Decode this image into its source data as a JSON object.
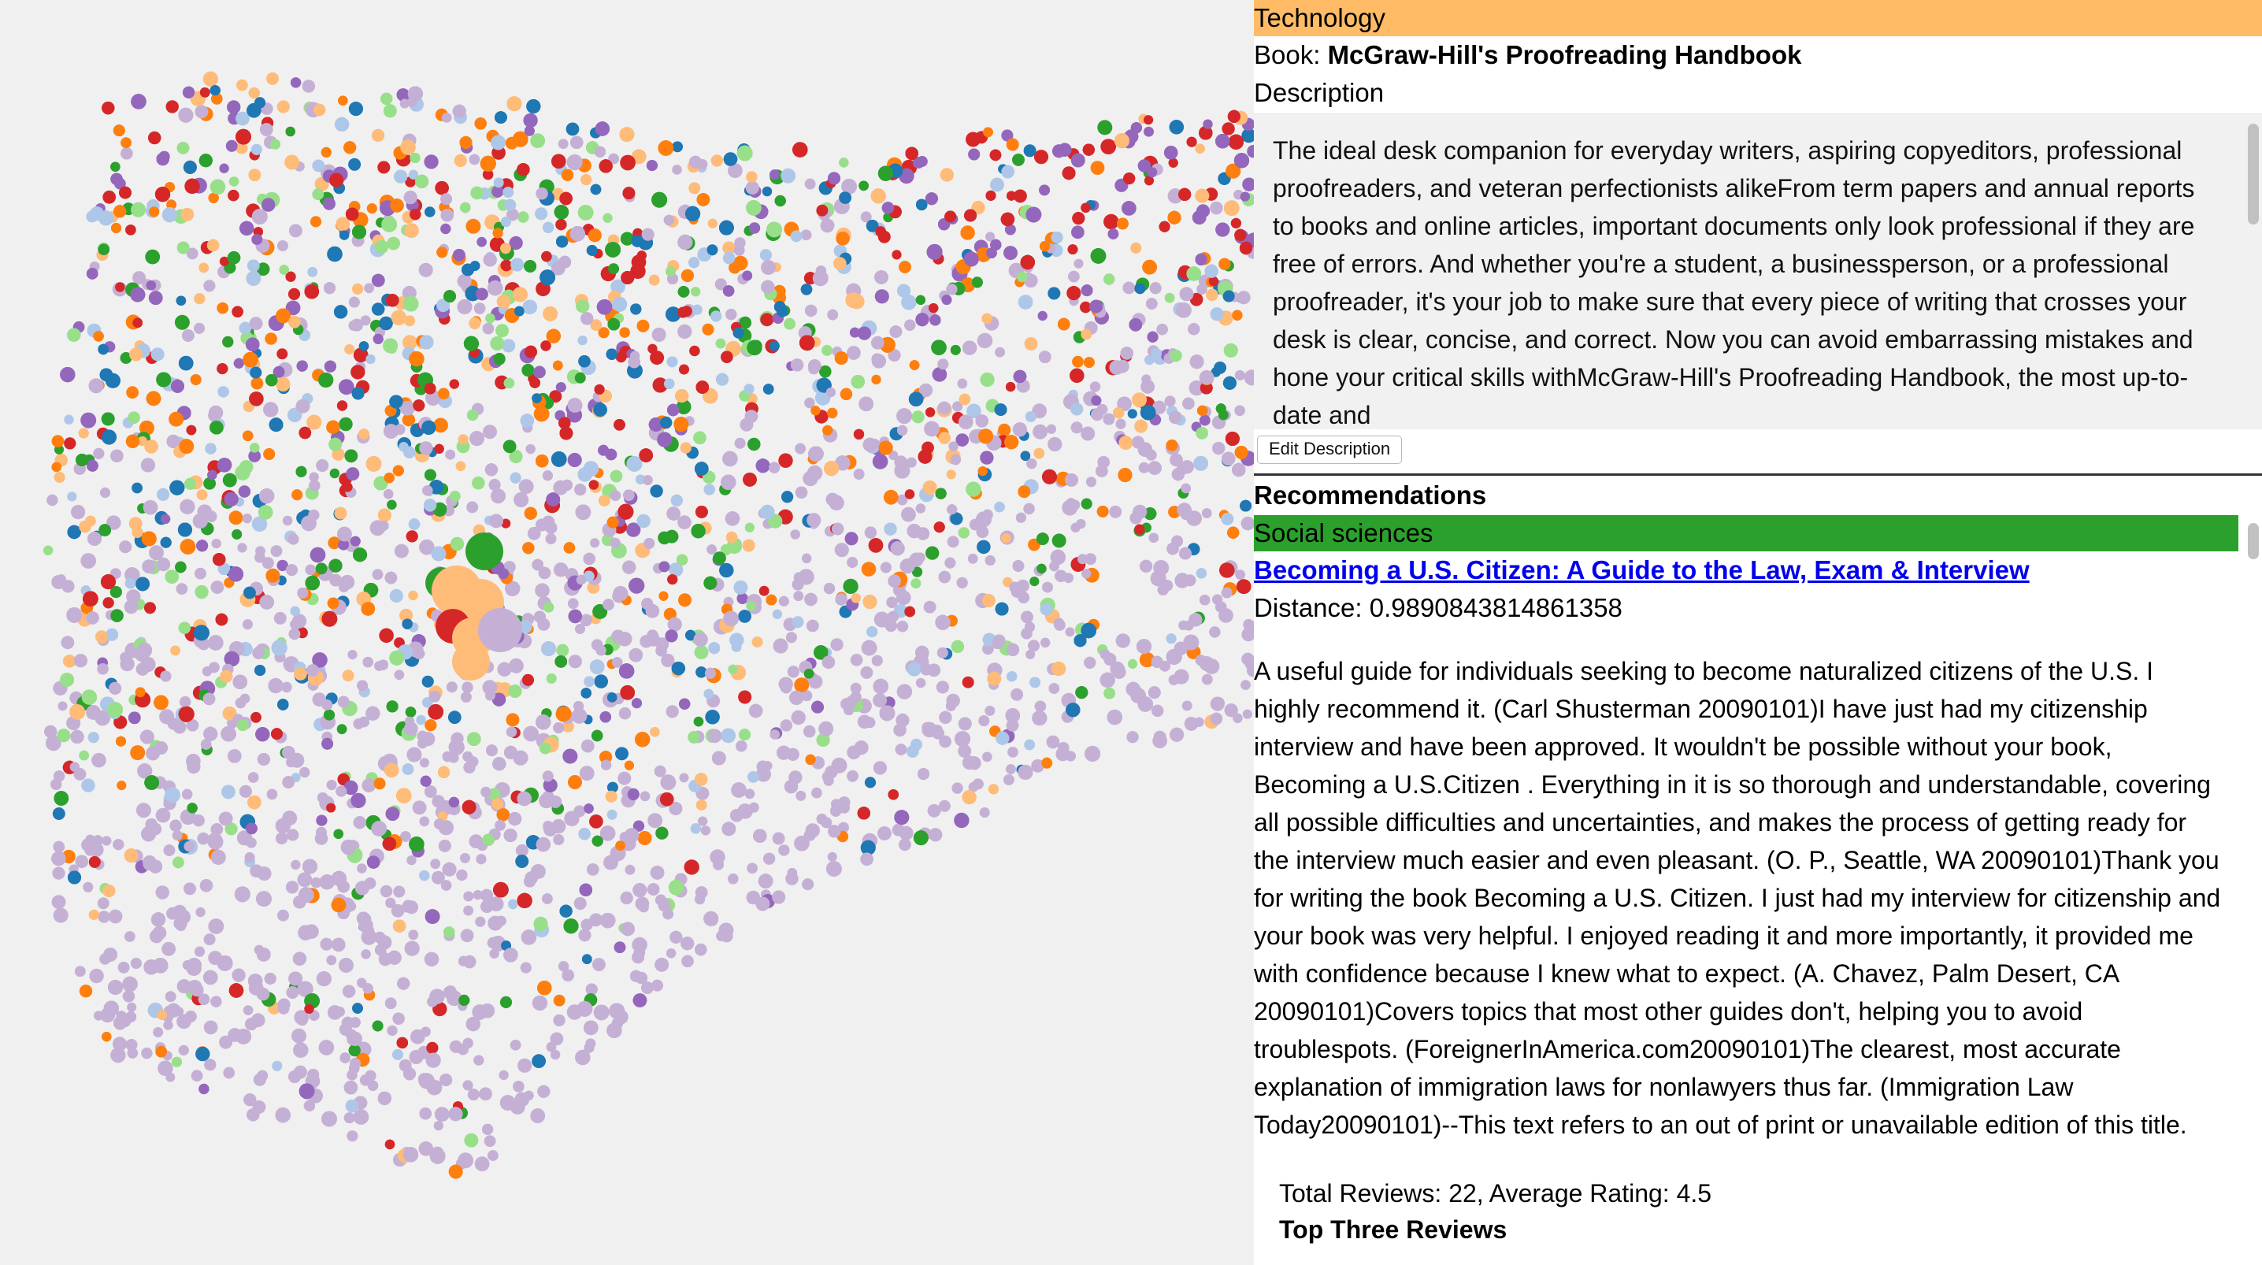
{
  "panel": {
    "current_category": "Technology",
    "book_label": "Book:",
    "book_title": "McGraw-Hill's Proofreading Handbook",
    "description_label": "Description",
    "description_text": "The ideal desk companion for everyday writers, aspiring copyeditors, professional proofreaders, and veteran perfectionists alikeFrom term papers and annual reports to books and online articles, important documents only look professional if they are free of errors. And whether you're a student, a businessperson, or a professional proofreader, it's your job to make sure that every piece of writing that crosses your desk is clear, concise, and correct. Now you can avoid embarrassing mistakes and hone your critical skills withMcGraw-Hill's Proofreading Handbook, the most up-to-date and",
    "edit_description_label": "Edit Description",
    "recommendations_label": "Recommendations",
    "recommendation": {
      "category": "Social sciences",
      "title": "Becoming a U.S. Citizen: A Guide to the Law, Exam & Interview",
      "distance": "Distance: 0.9890843814861358",
      "description": "A useful guide for individuals seeking to become naturalized citizens of the U.S. I highly recommend it. (Carl Shusterman 20090101)I have just had my citizenship interview and have been approved. It wouldn't be possible without your book, Becoming a U.S.Citizen . Everything in it is so thorough and understandable, covering all possible difficulties and uncertainties, and makes the process of getting ready for the interview much easier and even pleasant. (O. P., Seattle, WA 20090101)Thank you for writing the book Becoming a U.S. Citizen. I just had my interview for citizenship and your book was very helpful. I enjoyed reading it and more importantly, it provided me with confidence because I knew what to expect. (A. Chavez, Palm Desert, CA 20090101)Covers topics that most other guides don't, helping you to avoid troublespots. (ForeignerInAmerica.com20090101)The clearest, most accurate explanation of immigration laws for nonlawyers thus far. (Immigration Law Today20090101)--This text refers to an out of print or unavailable edition of this title.",
      "reviews_summary": "Total Reviews: 22, Average Rating: 4.5",
      "top_reviews_label": "Top Three Reviews"
    }
  },
  "colors": {
    "technology_bar": "#ffbb66",
    "social_sciences_bar": "#2ca02c",
    "link": "#0000ee",
    "background": "#f0f0f0"
  },
  "scatter": {
    "palette": [
      "#c5b0d5",
      "#c5b0d5",
      "#c5b0d5",
      "#ff7f0e",
      "#ffbb78",
      "#98df8a",
      "#2ca02c",
      "#1f77b4",
      "#aec7e8",
      "#9467bd",
      "#d62728"
    ],
    "highlighted_points_colors": [
      "#2ca02c",
      "#ffbb78",
      "#d62728"
    ]
  }
}
